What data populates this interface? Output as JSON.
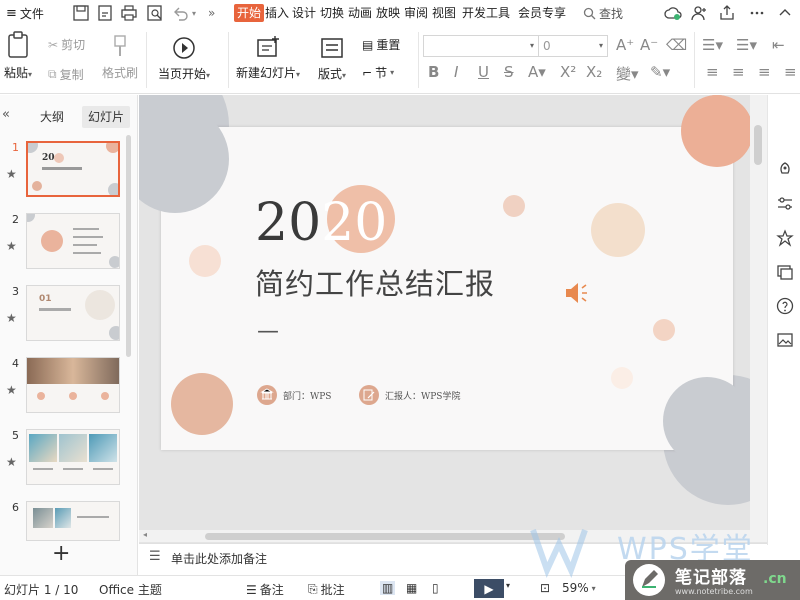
{
  "menubar": {
    "file": "文件",
    "tabs": [
      "开始",
      "插入",
      "设计",
      "切换",
      "动画",
      "放映",
      "审阅",
      "视图",
      "开发工具",
      "会员专享"
    ],
    "active_tab": "开始",
    "search": "查找",
    "more": "»"
  },
  "ribbon": {
    "paste": "粘贴",
    "cut": "剪切",
    "copy": "复制",
    "format_painter": "格式刷",
    "from_current": "当页开始",
    "new_slide": "新建幻灯片",
    "layout": "版式",
    "section": "节",
    "reset": "重置",
    "font_size": "0"
  },
  "left_panel": {
    "tab_outline": "大纲",
    "tab_slides": "幻灯片",
    "active_tab": "幻灯片",
    "thumbnails": [
      {
        "number": "1"
      },
      {
        "number": "2"
      },
      {
        "number": "3"
      },
      {
        "number": "4"
      },
      {
        "number": "5"
      },
      {
        "number": "6"
      }
    ],
    "add": "+"
  },
  "slide": {
    "year_dark": "20",
    "year_light": "20",
    "title": "简约工作总结汇报",
    "dash": "—",
    "department": "部门：WPS",
    "reporter": "汇报人：WPS学院"
  },
  "notes": {
    "placeholder": "单击此处添加备注"
  },
  "status": {
    "slide_counter": "幻灯片 1 / 10",
    "theme": "Office 主题",
    "notes": "备注",
    "comments": "批注",
    "zoom": "59%"
  },
  "watermark": {
    "wps": "WPS学堂",
    "brand": "笔记部落",
    "brand_cn": ".cn",
    "url": "www.notetribe.com"
  },
  "colors": {
    "accent": "#e8643c",
    "peach": "#ecaf96",
    "gray_circle": "#c5c8cc"
  }
}
